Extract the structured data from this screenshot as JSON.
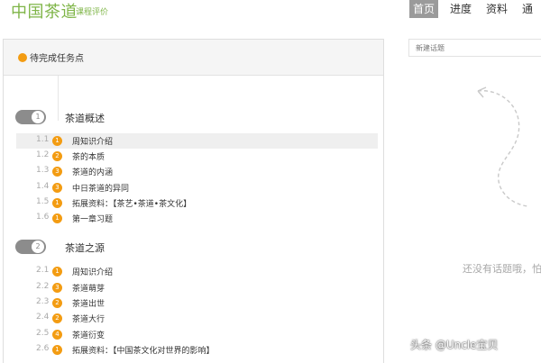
{
  "header": {
    "brand": "中国茶道",
    "subtitle": "课程评价",
    "nav": [
      {
        "label": "首页",
        "active": true
      },
      {
        "label": "进度",
        "active": false
      },
      {
        "label": "资料",
        "active": false
      },
      {
        "label": "通",
        "active": false
      }
    ]
  },
  "tasks": {
    "title": "待完成任务点",
    "chapters": [
      {
        "number": "1",
        "title": "茶道概述",
        "items": [
          {
            "num": "1.1",
            "badge": "1",
            "label": "周知识介绍",
            "selected": true
          },
          {
            "num": "1.2",
            "badge": "2",
            "label": "茶的本质",
            "selected": false
          },
          {
            "num": "1.3",
            "badge": "3",
            "label": "茶道的内涵",
            "selected": false
          },
          {
            "num": "1.4",
            "badge": "3",
            "label": "中日茶道的异同",
            "selected": false
          },
          {
            "num": "1.5",
            "badge": "1",
            "label": "拓展资料：【茶艺•茶道•茶文化】",
            "selected": false
          },
          {
            "num": "1.6",
            "badge": "1",
            "label": "第一章习题",
            "selected": false
          }
        ]
      },
      {
        "number": "2",
        "title": "茶道之源",
        "items": [
          {
            "num": "2.1",
            "badge": "1",
            "label": "周知识介绍",
            "selected": false
          },
          {
            "num": "2.2",
            "badge": "3",
            "label": "茶道萌芽",
            "selected": false
          },
          {
            "num": "2.3",
            "badge": "2",
            "label": "茶道出世",
            "selected": false
          },
          {
            "num": "2.4",
            "badge": "2",
            "label": "茶道大行",
            "selected": false
          },
          {
            "num": "2.5",
            "badge": "4",
            "label": "茶道衍变",
            "selected": false
          },
          {
            "num": "2.6",
            "badge": "1",
            "label": "拓展资料：【中国茶文化对世界的影响】",
            "selected": false
          }
        ]
      }
    ]
  },
  "topics": {
    "placeholder": "新建话题",
    "empty_text": "还没有话题哦，怕"
  },
  "watermark": "头条 @Uncle宝贝",
  "colors": {
    "brand": "#7fb548",
    "badge": "#f39c12",
    "nav_active": "#9a9a9a",
    "toggle": "#8c8c8c"
  },
  "icons": {
    "header_dot": "orange-dot-icon",
    "chapter_toggle": "toggle-switch-icon",
    "deco": "dashed-arrow-icon"
  }
}
